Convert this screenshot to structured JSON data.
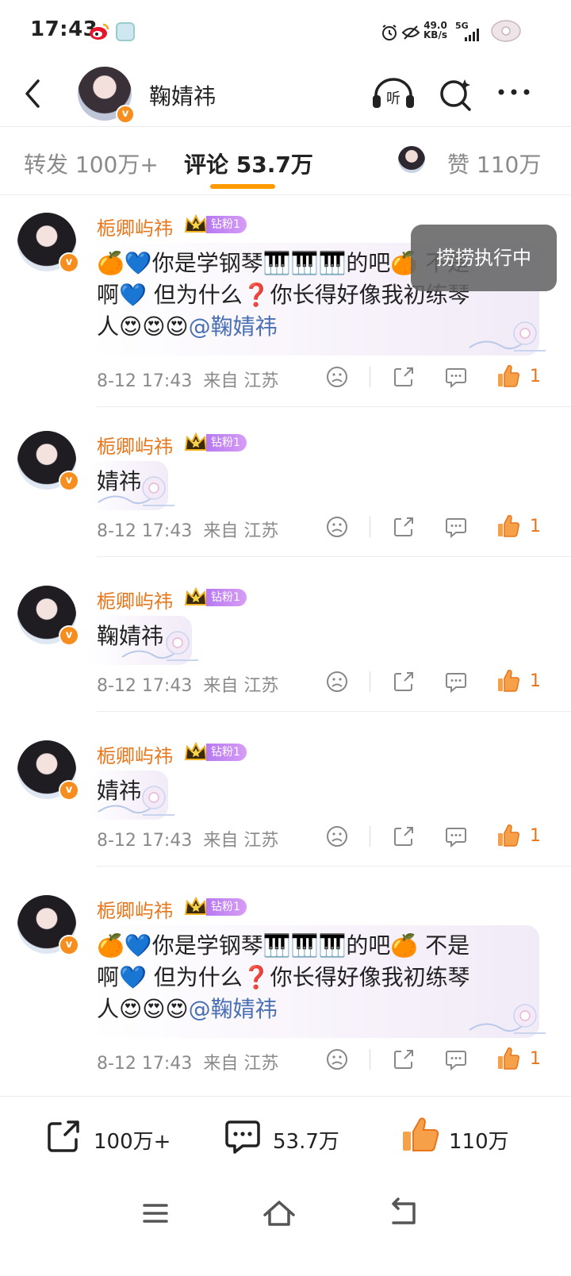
{
  "status_bar": {
    "time": "17:43",
    "net_speed": "49.0",
    "net_unit": "KB/s",
    "network": "5G"
  },
  "header": {
    "title": "鞠婧祎"
  },
  "tabs": {
    "repost": "转发 100万+",
    "comments": "评论 53.7万",
    "likes": "赞 110万"
  },
  "toast": "捞捞执行中",
  "comments": [
    {
      "user": "栀卿屿祎",
      "badge": "钻粉1",
      "lines": [
        "🍊💙你是学钢琴🎹🎹🎹的吧🍊 不是",
        "啊💙 但为什么❓你长得好像我初练琴",
        "人😍😍😍"
      ],
      "mention": "@鞠婧祎",
      "time": "8-12 17:43",
      "source": "来自 江苏",
      "likes": "1"
    },
    {
      "user": "栀卿屿祎",
      "badge": "钻粉1",
      "lines": [
        "婧祎"
      ],
      "mention": "",
      "time": "8-12 17:43",
      "source": "来自 江苏",
      "likes": "1"
    },
    {
      "user": "栀卿屿祎",
      "badge": "钻粉1",
      "lines": [
        "鞠婧祎"
      ],
      "mention": "",
      "time": "8-12 17:43",
      "source": "来自 江苏",
      "likes": "1"
    },
    {
      "user": "栀卿屿祎",
      "badge": "钻粉1",
      "lines": [
        "婧祎"
      ],
      "mention": "",
      "time": "8-12 17:43",
      "source": "来自 江苏",
      "likes": "1"
    },
    {
      "user": "栀卿屿祎",
      "badge": "钻粉1",
      "lines": [
        "🍊💙你是学钢琴🎹🎹🎹的吧🍊 不是",
        "啊💙 但为什么❓你长得好像我初练琴",
        "人😍😍😍"
      ],
      "mention": "@鞠婧祎",
      "time": "8-12 17:43",
      "source": "来自 江苏",
      "likes": "1"
    }
  ],
  "bottom_bar": {
    "repost": "100万+",
    "comment": "53.7万",
    "like": "110万"
  },
  "colors": {
    "accent": "#ff9a00",
    "username": "#e8751a",
    "mention": "#4a6fb3",
    "fan_badge": "#c98af4"
  },
  "icons": {
    "back": "chevron-left-icon",
    "listen": "headphones-icon",
    "search": "search-sparkle-icon",
    "more": "more-dots-icon",
    "dislike": "frown-icon",
    "share": "share-icon",
    "comment": "comment-icon",
    "like": "thumbs-up-icon"
  }
}
